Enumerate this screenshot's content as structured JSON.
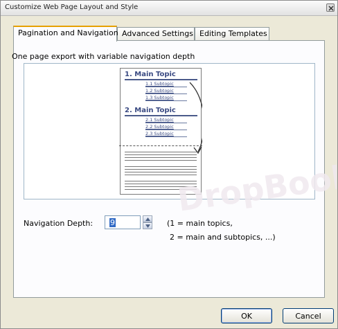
{
  "window": {
    "title": "Customize Web Page Layout and Style"
  },
  "tabs": [
    {
      "label": "Pagination and Navigation"
    },
    {
      "label": "Advanced Settings"
    },
    {
      "label": "Editing Templates"
    }
  ],
  "panel": {
    "title": "One page export with variable navigation depth",
    "preview": {
      "topics": [
        {
          "heading": "1. Main Topic",
          "subtopics": [
            "1.1 Subtopic",
            "1.2 Subtopic",
            "1.3 Subtopic"
          ]
        },
        {
          "heading": "2. Main Topic",
          "subtopics": [
            "2.1 Subtopic",
            "2.2 Subtopic",
            "2.3 Subtopic"
          ]
        }
      ]
    }
  },
  "navigation_depth": {
    "label": "Navigation Depth:",
    "value": "9",
    "hint_line1": "(1 = main topics,",
    "hint_line2": "2 = main and subtopics, ...)"
  },
  "buttons": {
    "ok": "OK",
    "cancel": "Cancel"
  },
  "watermark": "DropBook",
  "colors": {
    "tab_accent": "#e6a000",
    "link_blue": "#3a4a82",
    "selection": "#316ac5"
  }
}
